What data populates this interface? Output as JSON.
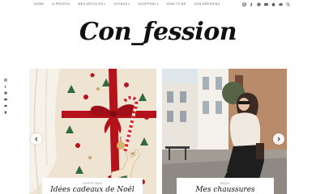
{
  "nav": {
    "items": [
      {
        "label": "Home",
        "caret": false
      },
      {
        "label": "À propos",
        "caret": false
      },
      {
        "label": "Mes articles",
        "caret": true
      },
      {
        "label": "Voyage",
        "caret": true
      },
      {
        "label": "Shopping",
        "caret": true
      },
      {
        "label": "How to be",
        "caret": false
      },
      {
        "label": "Son dressing",
        "caret": false
      }
    ],
    "caret_glyph": "▾",
    "social_icons": [
      "instagram-icon",
      "facebook-icon",
      "pinterest-icon",
      "youtube-icon",
      "snapchat-icon",
      "email-icon",
      "search-icon"
    ]
  },
  "logo": {
    "text": "Con_fession"
  },
  "sidebar": {
    "icons": [
      "instagram-icon",
      "facebook-icon",
      "pinterest-icon",
      "youtube-icon",
      "email-icon",
      "bloglovin-icon"
    ]
  },
  "slider": {
    "slides": [
      {
        "category": "Christmas",
        "title": "Idées cadeaux de Noël"
      },
      {
        "category": "Mode",
        "title": "Mes chaussures"
      }
    ],
    "prev_label": "previous",
    "next_label": "next"
  },
  "colors": {
    "ribbon": "#b5121b",
    "paper": "#f1e7d6",
    "tree": "#2f6b3b",
    "sky": "#dfe6ea",
    "building": "#b98b6a"
  }
}
